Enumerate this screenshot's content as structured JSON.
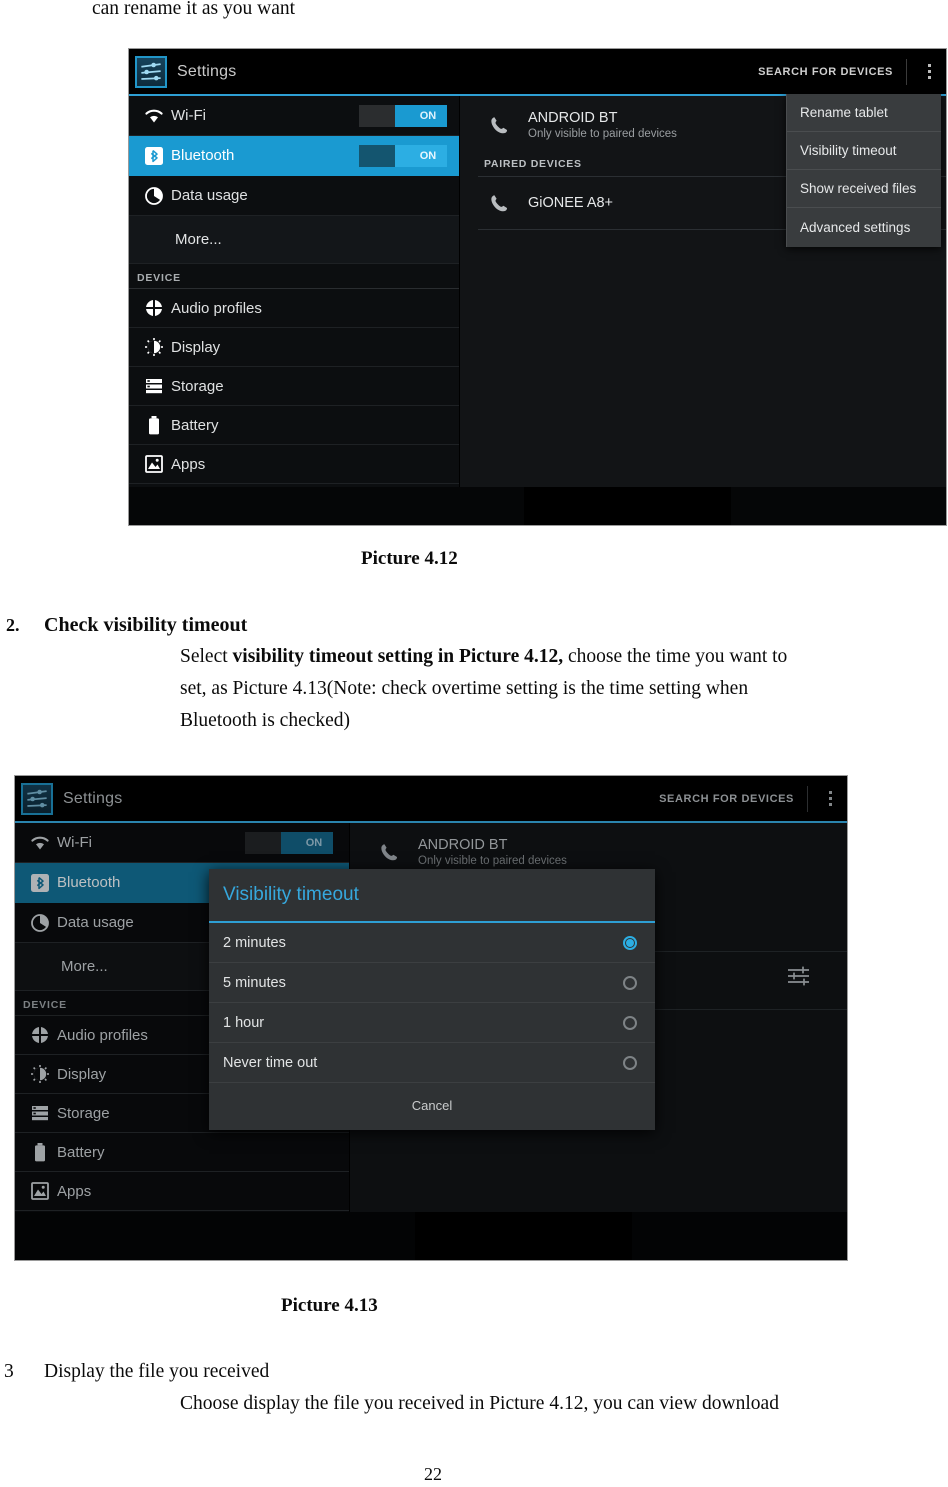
{
  "document": {
    "top_line": "can rename it as you want",
    "caption_1": "Picture 4.12",
    "caption_2": "Picture 4.13",
    "section2_number": "2.",
    "section2_title": "Check visibility timeout",
    "section2_body_1a": "Select ",
    "section2_body_1b": "visibility timeout setting in Picture 4.12,",
    "section2_body_1c": " choose the time you want to",
    "section2_body_2": "set, as Picture 4.13(Note: check overtime setting is the time setting when",
    "section2_body_3": "Bluetooth is checked)",
    "section3_number": "3",
    "section3_title": "Display the file you received",
    "section3_body_1": "Choose display the file you received in Picture 4.12, you can view download",
    "page_number": "22"
  },
  "colors": {
    "accent": "#1a9ad1",
    "accent_light": "#2caee3",
    "dialog_title": "#36a8dd",
    "bg_dark": "#0c0e10",
    "panel": "#121416",
    "popup": "#393c3e"
  },
  "picture412": {
    "actionbar": {
      "app_title": "Settings",
      "app_icon": "settings-sliders-icon",
      "search_label": "SEARCH FOR DEVICES",
      "overflow_icon": "overflow-menu-icon"
    },
    "sidebar": {
      "items": [
        {
          "label": "Wi-Fi",
          "icon": "wifi-icon",
          "toggle": "ON",
          "selected": false,
          "has_icon": true
        },
        {
          "label": "Bluetooth",
          "icon": "bluetooth-icon",
          "toggle": "ON",
          "selected": true,
          "has_icon": true
        },
        {
          "label": "Data usage",
          "icon": "data-usage-icon",
          "toggle": null,
          "selected": false,
          "has_icon": true
        },
        {
          "label": "More...",
          "icon": null,
          "toggle": null,
          "selected": false,
          "has_icon": false
        }
      ],
      "section_header": "DEVICE",
      "device_items": [
        {
          "label": "Audio profiles",
          "icon": "audio-profiles-icon"
        },
        {
          "label": "Display",
          "icon": "display-brightness-icon"
        },
        {
          "label": "Storage",
          "icon": "storage-icon"
        },
        {
          "label": "Battery",
          "icon": "battery-icon"
        },
        {
          "label": "Apps",
          "icon": "apps-image-icon"
        }
      ]
    },
    "bluetooth_panel": {
      "self_name": "ANDROID BT",
      "self_sub": "Only visible to paired devices",
      "self_icon": "phone-handset-icon",
      "paired_header": "PAIRED DEVICES",
      "paired": [
        {
          "name": "GiONEE A8+",
          "icon": "phone-handset-icon"
        }
      ]
    },
    "overflow_menu": {
      "items": [
        "Rename tablet",
        "Visibility timeout",
        "Show received files",
        "Advanced settings"
      ]
    }
  },
  "picture413": {
    "actionbar": {
      "app_title": "Settings",
      "app_icon": "settings-sliders-icon",
      "search_label": "SEARCH FOR DEVICES",
      "overflow_icon": "overflow-menu-icon"
    },
    "sidebar": {
      "items": [
        {
          "label": "Wi-Fi",
          "icon": "wifi-icon",
          "toggle": "ON",
          "selected": false,
          "has_icon": true
        },
        {
          "label": "Bluetooth",
          "icon": "bluetooth-icon",
          "toggle": null,
          "selected": true,
          "has_icon": true
        },
        {
          "label": "Data usage",
          "icon": "data-usage-icon",
          "toggle": null,
          "selected": false,
          "has_icon": true
        },
        {
          "label": "More...",
          "icon": null,
          "toggle": null,
          "selected": false,
          "has_icon": false
        }
      ],
      "section_header": "DEVICE",
      "device_items": [
        {
          "label": "Audio profiles",
          "icon": "audio-profiles-icon"
        },
        {
          "label": "Display",
          "icon": "display-brightness-icon"
        },
        {
          "label": "Storage",
          "icon": "storage-icon"
        },
        {
          "label": "Battery",
          "icon": "battery-icon"
        },
        {
          "label": "Apps",
          "icon": "apps-image-icon"
        }
      ]
    },
    "bluetooth_panel": {
      "self_name": "ANDROID BT",
      "self_sub": "Only visible to paired devices",
      "self_icon": "phone-handset-icon",
      "settings_icon": "device-settings-sliders-icon"
    },
    "dialog": {
      "title": "Visibility timeout",
      "options": [
        {
          "label": "2 minutes",
          "selected": true
        },
        {
          "label": "5 minutes",
          "selected": false
        },
        {
          "label": "1 hour",
          "selected": false
        },
        {
          "label": "Never time out",
          "selected": false
        }
      ],
      "cancel_label": "Cancel"
    }
  }
}
